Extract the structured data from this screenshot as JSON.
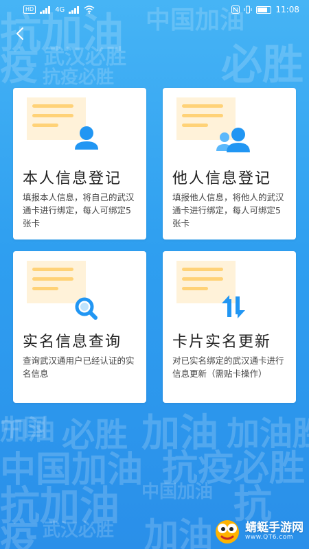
{
  "status_bar": {
    "network": "4G",
    "time": "11:08"
  },
  "background_slogans": [
    "抗加油",
    "中国加油",
    "必胜",
    "疫",
    "武汉必胜",
    "抗疫必胜",
    "加油",
    "中国",
    "加油胜",
    "必胜",
    "加油",
    "中国加油",
    "抗疫必胜",
    "抗加油",
    "中国加油",
    "抗",
    "疫",
    "武汉必胜",
    "加油"
  ],
  "cards": [
    {
      "title": "本人信息登记",
      "description": "填报本人信息，将自己的武汉通卡进行绑定，每人可绑定5张卡",
      "icon": "user-icon"
    },
    {
      "title": "他人信息登记",
      "description": "填报他人信息，将他人的武汉通卡进行绑定，每人可绑定5张卡",
      "icon": "users-icon"
    },
    {
      "title": "实名信息查询",
      "description": "查询武汉通用户已经认证的实名信息",
      "icon": "search-icon"
    },
    {
      "title": "卡片实名更新",
      "description": "对已实名绑定的武汉通卡进行信息更新（需贴卡操作）",
      "icon": "update-arrows-icon"
    }
  ],
  "watermark": {
    "name": "蜻蜓手游网",
    "domain": "www.QT6.com"
  },
  "colors": {
    "accent": "#2196f3",
    "card_bg": "#ffffff",
    "illus_bg": "#fff2d9",
    "illus_lines": "#ffd277"
  }
}
